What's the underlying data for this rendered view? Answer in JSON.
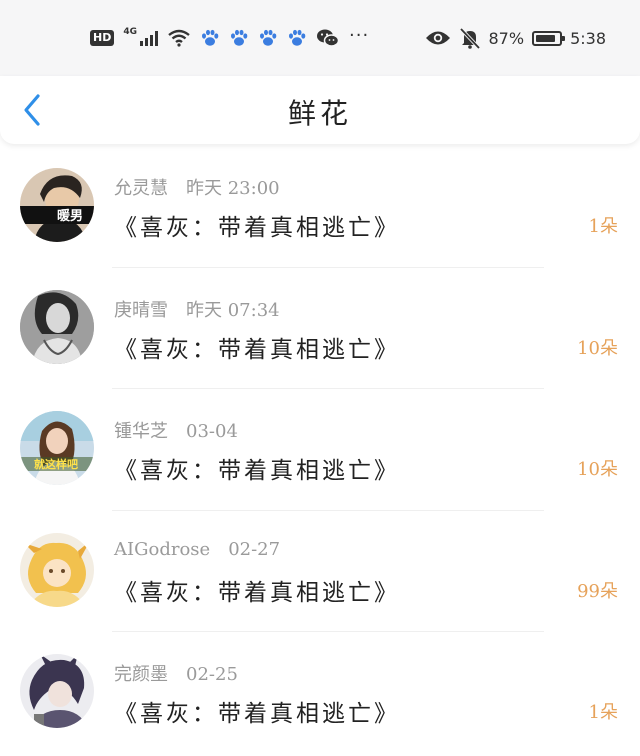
{
  "status_bar": {
    "hd": "HD",
    "network": "4G",
    "overflow": "···",
    "battery_text": "87%",
    "battery_level": 0.87,
    "time": "5:38",
    "icons": [
      "hd-icon",
      "signal-icon",
      "wifi-icon",
      "paw-icon",
      "paw-icon",
      "paw-icon",
      "paw-icon",
      "wechat-icon",
      "more-icon",
      "eye-icon",
      "bell-muted-icon",
      "battery-icon"
    ]
  },
  "header": {
    "back_icon": "chevron-left-icon",
    "title": "鲜花"
  },
  "colors": {
    "accent": "#2f8fe8",
    "count": "#e6a25a",
    "meta": "#9a9a9a"
  },
  "items": [
    {
      "user": "允灵慧",
      "time": "昨天 23:00",
      "book": "《喜灰：带着真相逃亡》",
      "count": "1朵",
      "avatar_label": "暖男"
    },
    {
      "user": "庚晴雪",
      "time": "昨天 07:34",
      "book": "《喜灰：带着真相逃亡》",
      "count": "10朵"
    },
    {
      "user": "锺华芝",
      "time": "03-04",
      "book": "《喜灰：带着真相逃亡》",
      "count": "10朵",
      "avatar_label": "就这样吧"
    },
    {
      "user": "AIGodrose",
      "time": "02-27",
      "book": "《喜灰：带着真相逃亡》",
      "count": "99朵"
    },
    {
      "user": "完颜墨",
      "time": "02-25",
      "book": "《喜灰：带着真相逃亡》",
      "count": "1朵"
    }
  ]
}
